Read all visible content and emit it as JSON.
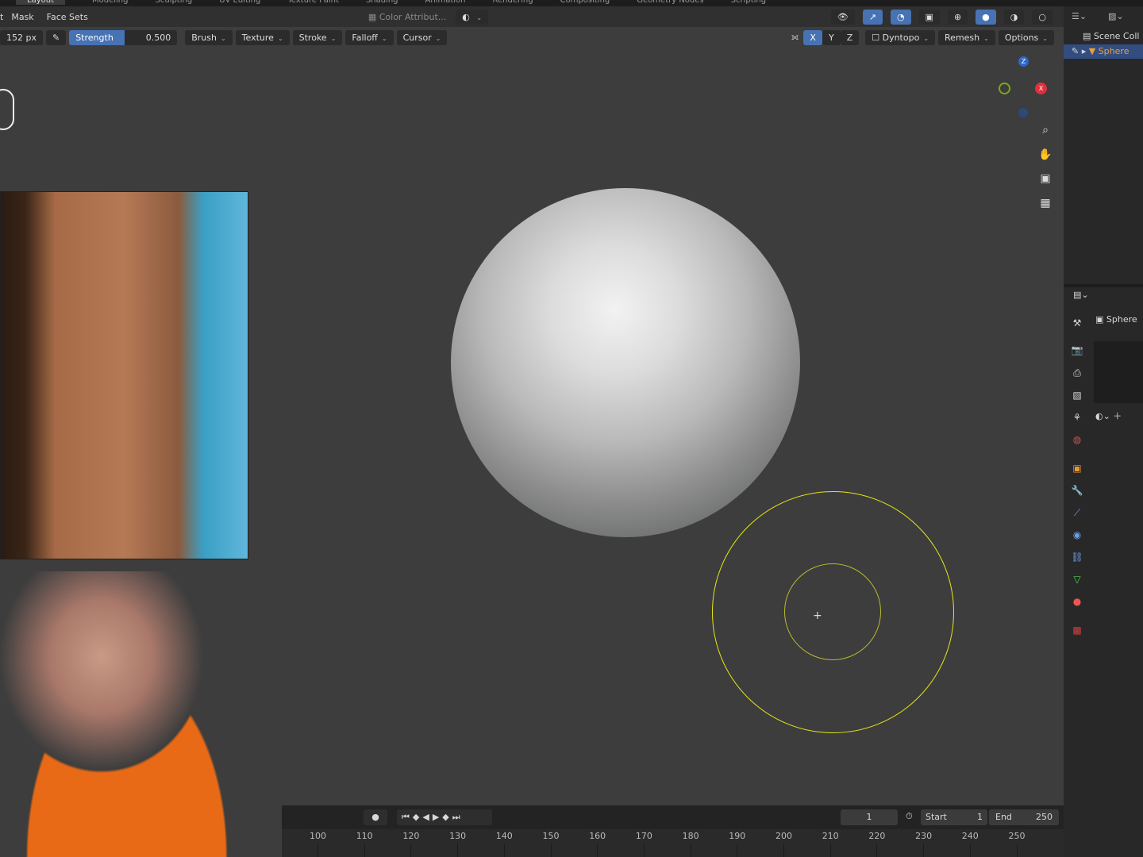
{
  "workspace_tabs": [
    "Layout",
    "Modeling",
    "Sculpting",
    "UV Editing",
    "Texture Paint",
    "Shading",
    "Animation",
    "Rendering",
    "Compositing",
    "Geometry Nodes",
    "Scripting"
  ],
  "header": {
    "menu_partial": "t",
    "mask": "Mask",
    "face_sets": "Face Sets",
    "color_attribute": "Color Attribut..."
  },
  "toolbar": {
    "radius": "152 px",
    "strength_label": "Strength",
    "strength_value": "0.500",
    "brush": "Brush",
    "texture": "Texture",
    "stroke": "Stroke",
    "falloff": "Falloff",
    "cursor": "Cursor",
    "x": "X",
    "y": "Y",
    "z": "Z",
    "dyntopo": "Dyntopo",
    "remesh": "Remesh",
    "options": "Options"
  },
  "gizmo": {
    "z": "Z",
    "x": "X"
  },
  "outliner": {
    "scene_collection": "Scene Coll",
    "object": "Sphere"
  },
  "properties": {
    "object_name": "Sphere"
  },
  "timeline": {
    "current_frame": "1",
    "start_label": "Start",
    "start": "1",
    "end_label": "End",
    "end": "250",
    "ticks": [
      "100",
      "110",
      "120",
      "130",
      "140",
      "150",
      "160",
      "170",
      "180",
      "190",
      "200",
      "210",
      "220",
      "230",
      "240",
      "250"
    ]
  },
  "colors": {
    "accent": "#4772b3",
    "brush_ring": "#e6e617",
    "selected": "#e8a23a"
  }
}
